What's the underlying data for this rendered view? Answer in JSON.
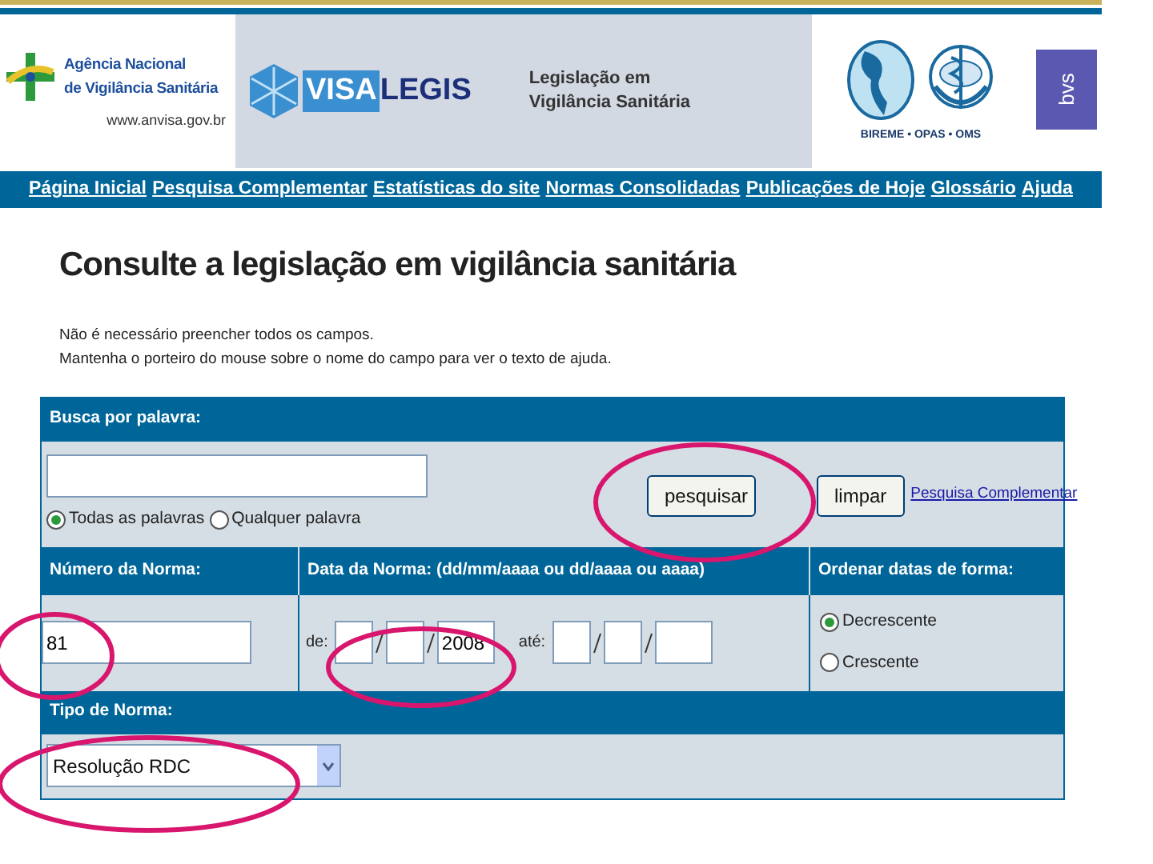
{
  "header": {
    "agency_lines": [
      "Agência Nacional",
      "de Vigilância Sanitária"
    ],
    "agency_url": "www.anvisa.gov.br",
    "product_logo": [
      "VISA",
      "LEGIS"
    ],
    "tagline_lines": [
      "Legislação em",
      "Vigilância Sanitária"
    ],
    "partners": "BIREME • OPAS • OMS",
    "bvs": "bvs"
  },
  "nav": [
    "Página Inicial",
    "Pesquisa Complementar",
    "Estatísticas do site",
    "Normas Consolidadas",
    "Publicações de Hoje",
    "Glossário",
    "Ajuda"
  ],
  "title": "Consulte a legislação em vigilância sanitária",
  "instructions": [
    "Não é necessário preencher todos os campos.",
    "Mantenha o porteiro do mouse sobre o nome do campo para ver o texto de ajuda."
  ],
  "form": {
    "keyword": {
      "label": "Busca por palavra:",
      "options": [
        {
          "label": "Todas as palavras",
          "selected": true
        },
        {
          "label": "Qualquer palavra",
          "selected": false
        }
      ],
      "buttons": [
        "pesquisar",
        "limpar"
      ],
      "link": "Pesquisa Complementar"
    },
    "number": {
      "label": "Número da Norma:",
      "value": "81"
    },
    "date": {
      "label": "Data da Norma: (dd/mm/aaaa ou dd/aaaa ou aaaa)",
      "from_label": "de:",
      "from_year": "2008",
      "to_label": "até:"
    },
    "order": {
      "label": "Ordenar datas de forma:",
      "options": [
        {
          "label": "Decrescente",
          "selected": true
        },
        {
          "label": "Crescente",
          "selected": false
        }
      ]
    },
    "type": {
      "label": "Tipo de Norma:",
      "value": "Resolução RDC"
    }
  }
}
